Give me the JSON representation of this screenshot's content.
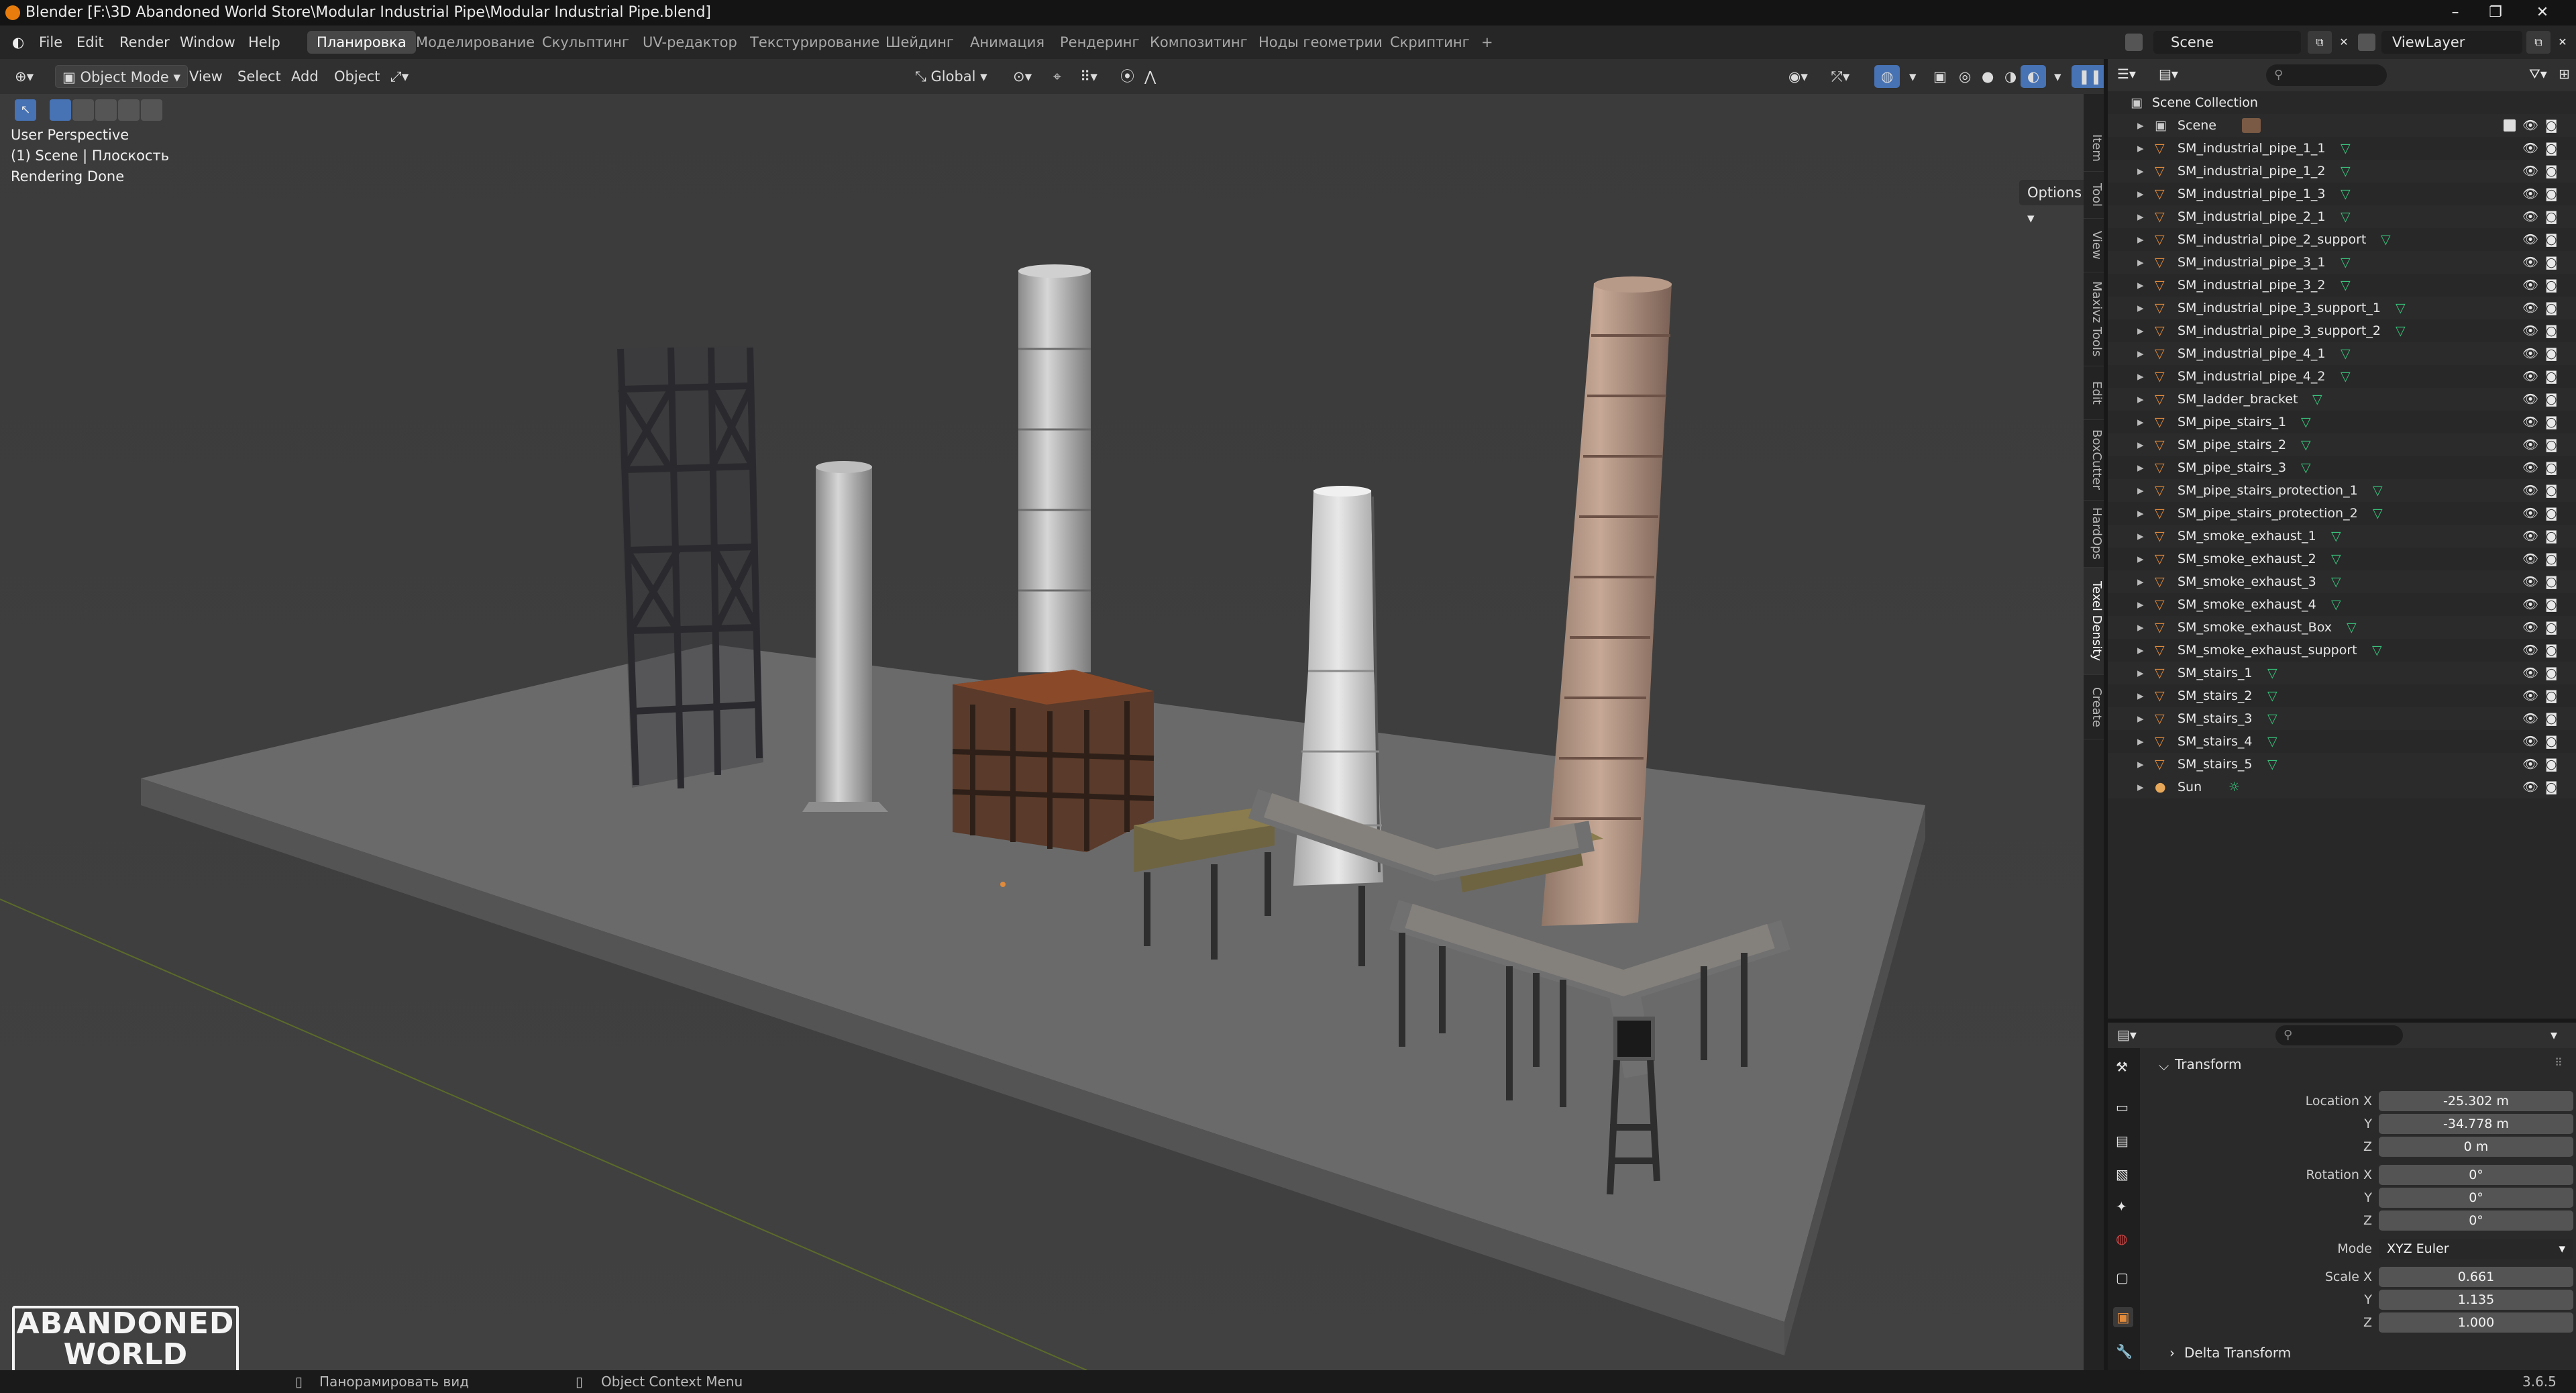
{
  "window": {
    "title": "Blender [F:\\3D Abandoned World Store\\Modular Industrial Pipe\\Modular Industrial Pipe.blend]"
  },
  "menu": {
    "file": "File",
    "edit": "Edit",
    "render": "Render",
    "window": "Window",
    "help": "Help"
  },
  "workspaces": [
    "Планировка",
    "Моделирование",
    "Скульптинг",
    "UV-редактор",
    "Текстурирование",
    "Шейдинг",
    "Анимация",
    "Рендеринг",
    "Композитинг",
    "Ноды геометрии",
    "Скриптинг"
  ],
  "active_workspace": "Планировка",
  "scene_field": {
    "name": "Scene",
    "view_layer": "ViewLayer"
  },
  "viewport_header": {
    "mode": "Object Mode",
    "view": "View",
    "select": "Select",
    "add": "Add",
    "object": "Object",
    "orientation": "Global",
    "options": "Options"
  },
  "viewport_overlay": {
    "line1": "User Perspective",
    "line2": "(1) Scene | Плоскость",
    "line3": "Rendering Done"
  },
  "sidebar_tabs": [
    "Item",
    "Tool",
    "View",
    "Maxivz Tools",
    "Edit",
    "BoxCutter",
    "HardOps",
    "Texel Density",
    "Create"
  ],
  "logo": {
    "line1": "ABANDONED",
    "line2": "WORLD"
  },
  "outliner": {
    "collection": "Scene Collection",
    "scene": "Scene",
    "items": [
      "SM_industrial_pipe_1_1",
      "SM_industrial_pipe_1_2",
      "SM_industrial_pipe_1_3",
      "SM_industrial_pipe_2_1",
      "SM_industrial_pipe_2_support",
      "SM_industrial_pipe_3_1",
      "SM_industrial_pipe_3_2",
      "SM_industrial_pipe_3_support_1",
      "SM_industrial_pipe_3_support_2",
      "SM_industrial_pipe_4_1",
      "SM_industrial_pipe_4_2",
      "SM_ladder_bracket",
      "SM_pipe_stairs_1",
      "SM_pipe_stairs_2",
      "SM_pipe_stairs_3",
      "SM_pipe_stairs_protection_1",
      "SM_pipe_stairs_protection_2",
      "SM_smoke_exhaust_1",
      "SM_smoke_exhaust_2",
      "SM_smoke_exhaust_3",
      "SM_smoke_exhaust_4",
      "SM_smoke_exhaust_Box",
      "SM_smoke_exhaust_support",
      "SM_stairs_1",
      "SM_stairs_2",
      "SM_stairs_3",
      "SM_stairs_4",
      "SM_stairs_5"
    ],
    "sun": "Sun"
  },
  "properties": {
    "panel": "Transform",
    "location_label": "Location X",
    "rotation_label": "Rotation X",
    "scale_label": "Scale X",
    "y_label": "Y",
    "z_label": "Z",
    "mode_label": "Mode",
    "location": [
      "-25.302 m",
      "-34.778 m",
      "0 m"
    ],
    "rotation": [
      "0°",
      "0°",
      "0°"
    ],
    "mode": "XYZ Euler",
    "scale": [
      "0.661",
      "1.135",
      "1.000"
    ],
    "delta": "Delta Transform"
  },
  "status": {
    "pan": "Панорамировать вид",
    "context": "Object Context Menu",
    "version": "3.6.5"
  },
  "colors": {
    "accent": "#4772b3",
    "mesh_icon": "#e08a3c",
    "green": "#38c27b"
  }
}
